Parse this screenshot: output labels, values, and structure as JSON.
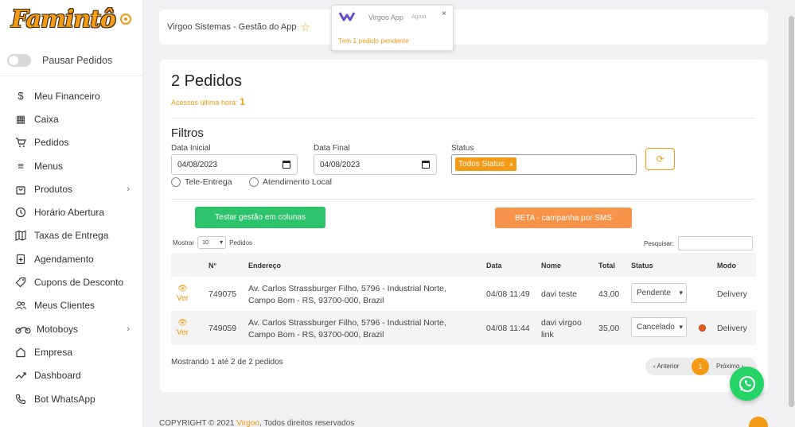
{
  "brand": {
    "logo_text": "Famintô"
  },
  "sidebar": {
    "pause_label": "Pausar Pedidos",
    "items": [
      {
        "label": "Meu Financeiro",
        "icon": "dollar-icon"
      },
      {
        "label": "Caixa",
        "icon": "table-icon"
      },
      {
        "label": "Pedidos",
        "icon": "cart-icon"
      },
      {
        "label": "Menus",
        "icon": "menu-icon"
      },
      {
        "label": "Produtos",
        "icon": "bag-icon",
        "has_children": true
      },
      {
        "label": "Horário Abertura",
        "icon": "clock-icon"
      },
      {
        "label": "Taxas de Entrega",
        "icon": "map-icon"
      },
      {
        "label": "Agendamento",
        "icon": "calendar-plus-icon"
      },
      {
        "label": "Cupons de Desconto",
        "icon": "tag-icon"
      },
      {
        "label": "Meus Clientes",
        "icon": "users-icon"
      },
      {
        "label": "Motoboys",
        "icon": "motorcycle-icon",
        "has_children": true
      },
      {
        "label": "Empresa",
        "icon": "home-icon"
      },
      {
        "label": "Dashboard",
        "icon": "trend-icon"
      },
      {
        "label": "Bot WhatsApp",
        "icon": "phone-icon"
      }
    ]
  },
  "header": {
    "title": "Virgoo Sistemas - Gestão do App"
  },
  "notification": {
    "app": "Virgoo App",
    "time": "Agora",
    "message": "Tem 1 pedido pendente"
  },
  "main": {
    "heading": "2 Pedidos",
    "acessos_label": "Acessos última hora:",
    "acessos_value": "1",
    "filters_title": "Filtros",
    "data_inicial_label": "Data Inicial",
    "data_inicial_value": "04/08/2023",
    "data_final_label": "Data Final",
    "data_final_value": "04/08/2023",
    "status_label": "Status",
    "status_chip": "Todos Status",
    "radio_tele": "Tele-Entrega",
    "radio_local": "Atendimento Local",
    "btn_colunas": "Testar gestão em colunas",
    "btn_sms": "BETA - campanha por SMS",
    "mostrar_label": "Mostrar",
    "mostrar_value": "10",
    "pedidos_label": "Pedidos",
    "pesquisar_label": "Pesquisar:"
  },
  "table": {
    "headers": {
      "num": "N°",
      "endereco": "Endereço",
      "data": "Data",
      "nome": "Nome",
      "total": "Total",
      "status": "Status",
      "modo": "Modo"
    },
    "ver_label": "Ver",
    "rows": [
      {
        "num": "749075",
        "endereco1": "Av. Carlos Strassburger Filho, 5796 - Industrial Norte,",
        "endereco2": "Campo Bom - RS, 93700-000, Brazil",
        "data": "04/08 11:49",
        "nome1": "davi teste",
        "nome2": "",
        "total": "43,00",
        "status": "Pendente",
        "modo": "Delivery"
      },
      {
        "num": "749059",
        "endereco1": "Av. Carlos Strassburger Filho, 5796 - Industrial Norte,",
        "endereco2": "Campo Bom - RS, 93700-000, Brazil",
        "data": "04/08 11:44",
        "nome1": "davi virgoo",
        "nome2": "link",
        "total": "35,00",
        "status": "Cancelado",
        "modo": "Delivery"
      }
    ]
  },
  "footer_info": {
    "mostrando": "Mostrando 1 até 2 de 2 pedidos",
    "prev": "‹ Anterior",
    "page": "1",
    "next": "Próximo ›"
  },
  "footer": {
    "copyright": "COPYRIGHT © 2021",
    "brand_link": "Virgoo",
    "rights": ", Todos direitos reservados"
  },
  "colors": {
    "accent": "#f39a16",
    "green": "#2dc36a",
    "sms": "#f7944a",
    "whatsapp": "#25d366"
  }
}
